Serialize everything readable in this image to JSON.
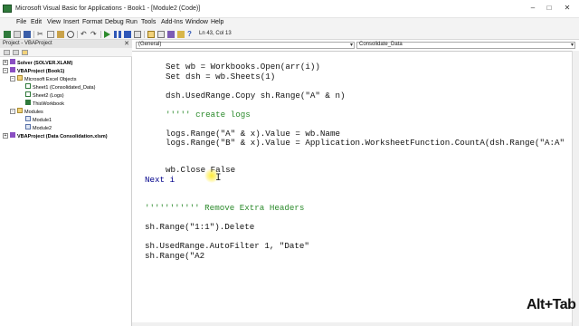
{
  "window": {
    "title": "Microsoft Visual Basic for Applications - Book1 - [Module2 (Code)]",
    "controls": [
      "–",
      "□",
      "✕"
    ]
  },
  "menu": [
    {
      "label": "File"
    },
    {
      "label": "Edit"
    },
    {
      "label": "View"
    },
    {
      "label": "Insert"
    },
    {
      "label": "Format"
    },
    {
      "label": "Debug"
    },
    {
      "label": "Run"
    },
    {
      "label": "Tools"
    },
    {
      "label": "Add-Ins"
    },
    {
      "label": "Window"
    },
    {
      "label": "Help"
    }
  ],
  "toolbar": {
    "cursor_position": "Ln 43, Col 13",
    "icons": [
      "excel-icon",
      "insert-module-icon",
      "save-icon",
      "cut-icon",
      "copy-icon",
      "paste-icon",
      "find-icon",
      "undo-icon",
      "redo-icon",
      "run-icon",
      "break-icon",
      "reset-icon",
      "design-mode-icon",
      "project-explorer-icon",
      "properties-icon",
      "object-browser-icon",
      "toolbox-icon",
      "help-icon"
    ]
  },
  "project_explorer": {
    "title": "Project - VBAProject",
    "close": "✕",
    "tree": [
      {
        "label": "Solver (SOLVER.XLAM)",
        "level": 0,
        "bold": true,
        "expander": "+"
      },
      {
        "label": "VBAProject (Book1)",
        "level": 0,
        "bold": true,
        "expander": "−"
      },
      {
        "label": "Microsoft Excel Objects",
        "level": 1,
        "bold": false,
        "expander": "−"
      },
      {
        "label": "Sheet1 (Consolidated_Data)",
        "level": 2,
        "bold": false,
        "expander": ""
      },
      {
        "label": "Sheet2 (Logs)",
        "level": 2,
        "bold": false,
        "expander": ""
      },
      {
        "label": "ThisWorkbook",
        "level": 2,
        "bold": false,
        "expander": ""
      },
      {
        "label": "Modules",
        "level": 1,
        "bold": false,
        "expander": "−"
      },
      {
        "label": "Module1",
        "level": 2,
        "bold": false,
        "expander": ""
      },
      {
        "label": "Module2",
        "level": 2,
        "bold": false,
        "expander": ""
      },
      {
        "label": "VBAProject (Data Consolidation.xlsm)",
        "level": 0,
        "bold": true,
        "expander": "+"
      }
    ]
  },
  "code_window": {
    "object_combo": "(General)",
    "procedure_combo": "Consolidate_Data",
    "lines": [
      {
        "text": "Set wb = Workbooks.Open(arr(i))",
        "indent": 1,
        "kind": "code"
      },
      {
        "text": "Set dsh = wb.Sheets(1)",
        "indent": 1,
        "kind": "code"
      },
      {
        "text": "",
        "indent": 0,
        "kind": "code"
      },
      {
        "text": "dsh.UsedRange.Copy sh.Range(\"A\" & n)",
        "indent": 1,
        "kind": "code"
      },
      {
        "text": "",
        "indent": 0,
        "kind": "code"
      },
      {
        "text": "''''' create logs",
        "indent": 1,
        "kind": "comment"
      },
      {
        "text": "",
        "indent": 0,
        "kind": "code"
      },
      {
        "text": "logs.Range(\"A\" & x).Value = wb.Name",
        "indent": 1,
        "kind": "code"
      },
      {
        "text": "logs.Range(\"B\" & x).Value = Application.WorksheetFunction.CountA(dsh.Range(\"A:A\"",
        "indent": 1,
        "kind": "code"
      },
      {
        "text": "",
        "indent": 0,
        "kind": "code"
      },
      {
        "text": "",
        "indent": 0,
        "kind": "code"
      },
      {
        "text": "wb.Close False",
        "indent": 1,
        "kind": "code"
      },
      {
        "text": "Next i",
        "indent": 0,
        "kind": "keyword"
      },
      {
        "text": "",
        "indent": 0,
        "kind": "code"
      },
      {
        "text": "",
        "indent": 0,
        "kind": "code"
      },
      {
        "text": "''''''''''' Remove Extra Headers",
        "indent": 0,
        "kind": "comment"
      },
      {
        "text": "",
        "indent": 0,
        "kind": "code"
      },
      {
        "text": "sh.Range(\"1:1\").Delete",
        "indent": 0,
        "kind": "code"
      },
      {
        "text": "",
        "indent": 0,
        "kind": "code"
      },
      {
        "text": "sh.UsedRange.AutoFilter 1, \"Date\"",
        "indent": 0,
        "kind": "code"
      },
      {
        "text": "sh.Range(\"A2",
        "indent": 0,
        "kind": "code"
      }
    ]
  },
  "watermark": "Alt+Tab",
  "colors": {
    "comment": "#2b8a2b",
    "keyword": "#00008b",
    "menubar": "#f3f3f3",
    "excel_green": "#2f7a3b"
  }
}
